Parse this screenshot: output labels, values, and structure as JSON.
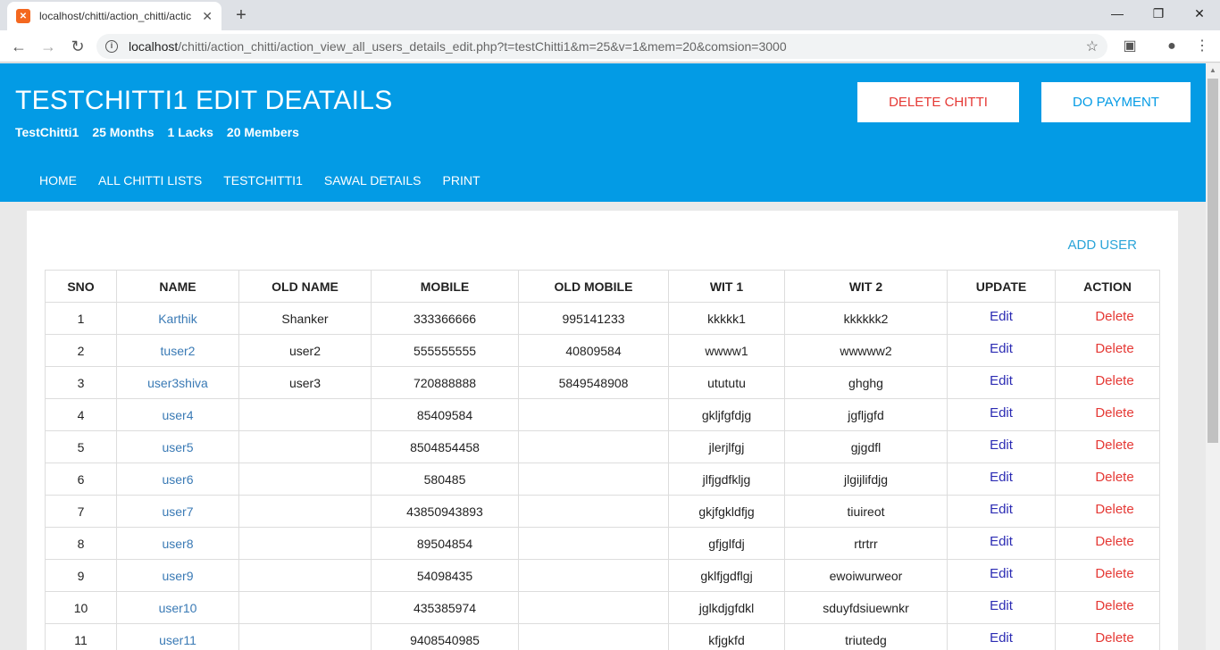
{
  "browser": {
    "tab_title": "localhost/chitti/action_chitti/actic",
    "url_host": "localhost",
    "url_path": "/chitti/action_chitti/action_view_all_users_details_edit.php?t=testChitti1&m=25&v=1&mem=20&comsion=3000"
  },
  "header": {
    "title": "TESTCHITTI1 EDIT DEATAILS",
    "meta": {
      "name": "TestChitti1",
      "months": "25 Months",
      "amount": "1 Lacks",
      "members": "20 Members"
    },
    "delete_label": "DELETE CHITTI",
    "payment_label": "DO PAYMENT",
    "menu": [
      "HOME",
      "ALL CHITTI LISTS",
      "TESTCHITTI1",
      "SAWAL DETAILS",
      "PRINT"
    ]
  },
  "main": {
    "add_user_label": "ADD USER",
    "columns": [
      "SNO",
      "NAME",
      "OLD NAME",
      "MOBILE",
      "OLD MOBILE",
      "WIT 1",
      "WIT 2",
      "UPDATE",
      "ACTION"
    ],
    "rows": [
      {
        "sno": "1",
        "name": "Karthik",
        "old_name": "Shanker",
        "mobile": "333366666",
        "old_mobile": "995141233",
        "wit1": "kkkkk1",
        "wit2": "kkkkkk2",
        "update": "Edit",
        "action": "Delete"
      },
      {
        "sno": "2",
        "name": "tuser2",
        "old_name": "user2",
        "mobile": "555555555",
        "old_mobile": "40809584",
        "wit1": "wwww1",
        "wit2": "wwwww2",
        "update": "Edit",
        "action": "Delete"
      },
      {
        "sno": "3",
        "name": "user3shiva",
        "old_name": "user3",
        "mobile": "720888888",
        "old_mobile": "5849548908",
        "wit1": "utututu",
        "wit2": "ghghg",
        "update": "Edit",
        "action": "Delete"
      },
      {
        "sno": "4",
        "name": "user4",
        "old_name": "",
        "mobile": "85409584",
        "old_mobile": "",
        "wit1": "gkljfgfdjg",
        "wit2": "jgfljgfd",
        "update": "Edit",
        "action": "Delete"
      },
      {
        "sno": "5",
        "name": "user5",
        "old_name": "",
        "mobile": "8504854458",
        "old_mobile": "",
        "wit1": "jlerjlfgj",
        "wit2": "gjgdfl",
        "update": "Edit",
        "action": "Delete"
      },
      {
        "sno": "6",
        "name": "user6",
        "old_name": "",
        "mobile": "580485",
        "old_mobile": "",
        "wit1": "jlfjgdfkljg",
        "wit2": "jlgijlifdjg",
        "update": "Edit",
        "action": "Delete"
      },
      {
        "sno": "7",
        "name": "user7",
        "old_name": "",
        "mobile": "43850943893",
        "old_mobile": "",
        "wit1": "gkjfgkldfjg",
        "wit2": "tiuireot",
        "update": "Edit",
        "action": "Delete"
      },
      {
        "sno": "8",
        "name": "user8",
        "old_name": "",
        "mobile": "89504854",
        "old_mobile": "",
        "wit1": "gfjglfdj",
        "wit2": "rtrtrr",
        "update": "Edit",
        "action": "Delete"
      },
      {
        "sno": "9",
        "name": "user9",
        "old_name": "",
        "mobile": "54098435",
        "old_mobile": "",
        "wit1": "gklfjgdflgj",
        "wit2": "ewoiwurweor",
        "update": "Edit",
        "action": "Delete"
      },
      {
        "sno": "10",
        "name": "user10",
        "old_name": "",
        "mobile": "435385974",
        "old_mobile": "",
        "wit1": "jglkdjgfdkl",
        "wit2": "sduyfdsiuewnkr",
        "update": "Edit",
        "action": "Delete"
      },
      {
        "sno": "11",
        "name": "user11",
        "old_name": "",
        "mobile": "9408540985",
        "old_mobile": "",
        "wit1": "kfjgkfd",
        "wit2": "triutedg",
        "update": "Edit",
        "action": "Delete"
      }
    ]
  }
}
